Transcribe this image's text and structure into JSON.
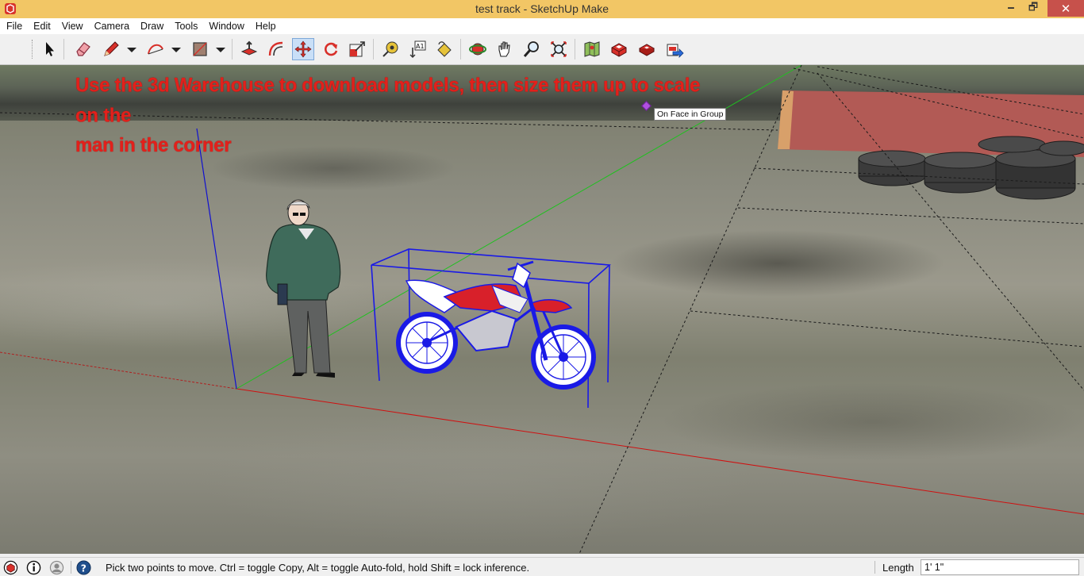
{
  "window": {
    "title": "test track - SketchUp Make",
    "minimize": "🗕",
    "restore": "🗗",
    "close": "✕"
  },
  "menu": {
    "items": [
      "File",
      "Edit",
      "View",
      "Camera",
      "Draw",
      "Tools",
      "Window",
      "Help"
    ]
  },
  "toolbar": {
    "tools": [
      {
        "name": "select-tool-icon"
      },
      {
        "name": "eraser-tool-icon"
      },
      {
        "name": "pencil-line-tool-icon"
      },
      {
        "name": "arc-tool-icon"
      },
      {
        "name": "rectangle-tool-icon"
      },
      {
        "name": "push-pull-tool-icon"
      },
      {
        "name": "offset-tool-icon"
      },
      {
        "name": "move-tool-icon",
        "active": true
      },
      {
        "name": "rotate-tool-icon"
      },
      {
        "name": "scale-tool-icon"
      },
      {
        "name": "tape-measure-tool-icon"
      },
      {
        "name": "text-tool-icon"
      },
      {
        "name": "paint-bucket-tool-icon"
      },
      {
        "name": "orbit-tool-icon"
      },
      {
        "name": "pan-tool-icon"
      },
      {
        "name": "zoom-tool-icon"
      },
      {
        "name": "zoom-extents-tool-icon"
      },
      {
        "name": "add-location-icon"
      },
      {
        "name": "3d-warehouse-icon"
      },
      {
        "name": "extension-warehouse-icon"
      },
      {
        "name": "share-model-icon"
      }
    ]
  },
  "viewport": {
    "instruction_line1": "Use the 3d Warehouse to download models, then size them up to scale on the",
    "instruction_line2": "man in the corner",
    "tooltip": "On Face in Group"
  },
  "status": {
    "message": "Pick two points to move.  Ctrl = toggle Copy, Alt = toggle Auto-fold, hold Shift = lock inference.",
    "length_label": "Length",
    "length_value": "1' 1\""
  },
  "colors": {
    "titlebar": "#f2c665",
    "close": "#c7514b",
    "annotation": "#e3201b",
    "selection": "#1a1ae6",
    "red_axis": "#d01010",
    "green_axis": "#20c020",
    "blue_axis": "#1010d0"
  }
}
